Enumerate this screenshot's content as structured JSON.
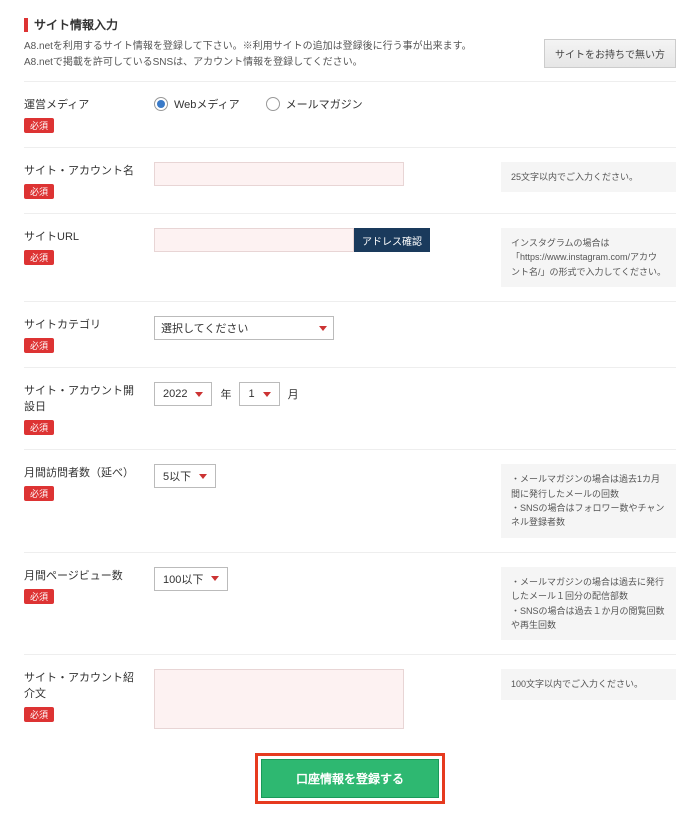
{
  "section_title": "サイト情報入力",
  "intro_line1": "A8.netを利用するサイト情報を登録して下さい。※利用サイトの追加は登録後に行う事が出来ます。",
  "intro_line2": "A8.netで掲載を許可しているSNSは、アカウント情報を登録してください。",
  "no_site_btn": "サイトをお持ちで無い方",
  "required_label": "必須",
  "rows": {
    "media": {
      "label": "運営メディア",
      "option_web": "Webメディア",
      "option_mail": "メールマガジン"
    },
    "name": {
      "label": "サイト・アカウント名",
      "hint": "25文字以内でご入力ください。"
    },
    "url": {
      "label": "サイトURL",
      "check_btn": "アドレス確認",
      "hint": "インスタグラムの場合は「https://www.instagram.com/アカウント名/」の形式で入力してください。"
    },
    "category": {
      "label": "サイトカテゴリ",
      "select_placeholder": "選択してください"
    },
    "opened": {
      "label": "サイト・アカウント開設日",
      "year_value": "2022",
      "year_unit": "年",
      "month_value": "1",
      "month_unit": "月"
    },
    "visitors": {
      "label": "月間訪問者数（延べ）",
      "select_value": "5以下",
      "hints": [
        "メールマガジンの場合は過去1カ月間に発行したメールの回数",
        "SNSの場合はフォロワー数やチャンネル登録者数"
      ]
    },
    "pv": {
      "label": "月間ページビュー数",
      "select_value": "100以下",
      "hints": [
        "メールマガジンの場合は過去に発行したメール１回分の配信部数",
        "SNSの場合は過去１か月の閲覧回数や再生回数"
      ]
    },
    "desc": {
      "label": "サイト・アカウント紹介文",
      "hint": "100文字以内でご入力ください。"
    }
  },
  "submit_label": "口座情報を登録する"
}
